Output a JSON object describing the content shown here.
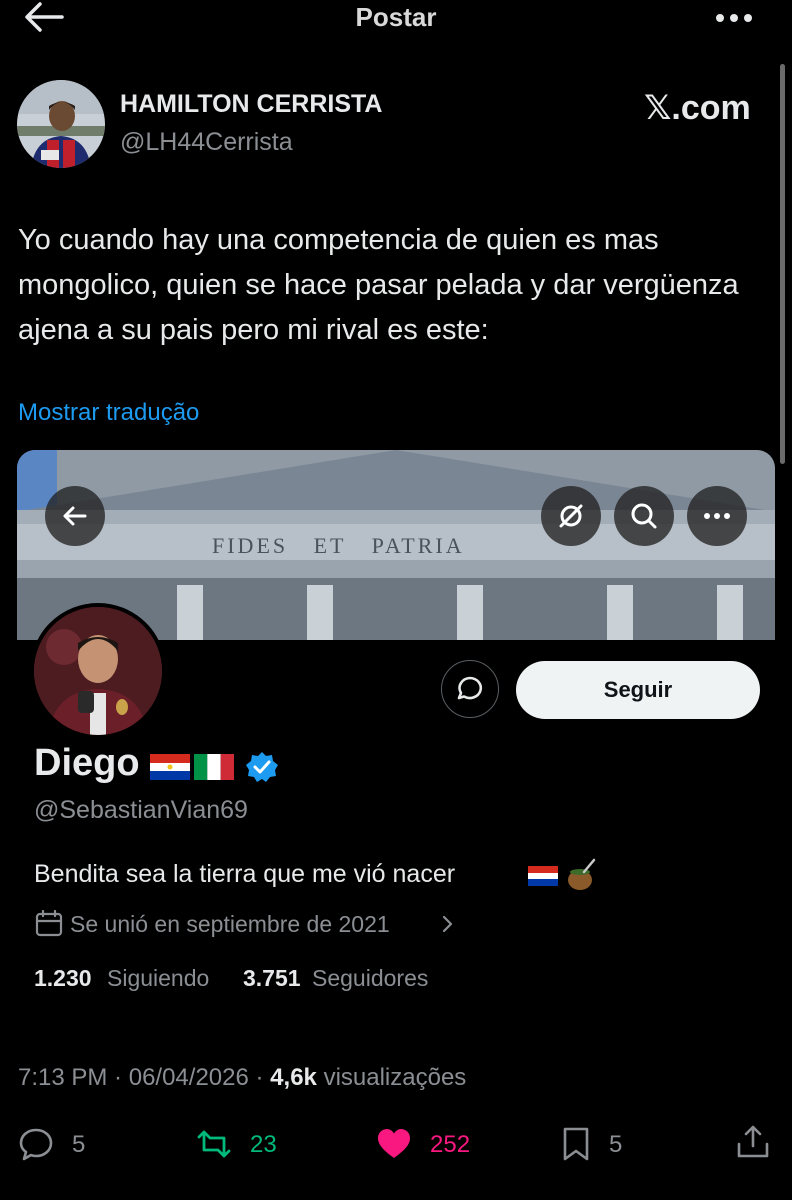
{
  "header": {
    "title": "Postar"
  },
  "tweet": {
    "author_name": "HAMILTON CERRISTA",
    "author_handle": "@LH44Cerrista",
    "brand": "𝕏.com",
    "text": "Yo cuando hay una competencia de quien es mas mongolico, quien se hace pasar pelada y dar vergüenza ajena a su pais pero mi rival es este:",
    "translate_label": "Mostrar tradução",
    "time": "7:13 PM",
    "date": "06/04/2026",
    "views_count": "4,6k",
    "views_label": "visualizações",
    "separator": " · "
  },
  "profile_card": {
    "banner_text": "FIDES   ET   PATRIA",
    "name": "Diego",
    "handle": "@SebastianVian69",
    "bio": "Bendita sea la tierra que me vió nacer",
    "joined": "Se unió en septiembre de 2021",
    "following_count": "1.230",
    "following_label": "Siguiendo",
    "followers_count": "3.751",
    "followers_label": "Seguidores",
    "follow_button": "Seguir"
  },
  "actions": {
    "reply_count": "5",
    "retweet_count": "23",
    "like_count": "252",
    "bookmark_count": "5"
  },
  "colors": {
    "background": "#000000",
    "link": "#1d9bf0",
    "retweet": "#00ba7c",
    "like": "#f91880",
    "muted": "#8b8f94",
    "verified": "#1d9bf0"
  },
  "icons": [
    "back-arrow-icon",
    "more-icon",
    "link-icon",
    "search-icon",
    "message-icon",
    "verified-icon",
    "calendar-icon",
    "chevron-right-icon",
    "reply-icon",
    "retweet-icon",
    "like-icon",
    "bookmark-icon",
    "share-icon"
  ]
}
